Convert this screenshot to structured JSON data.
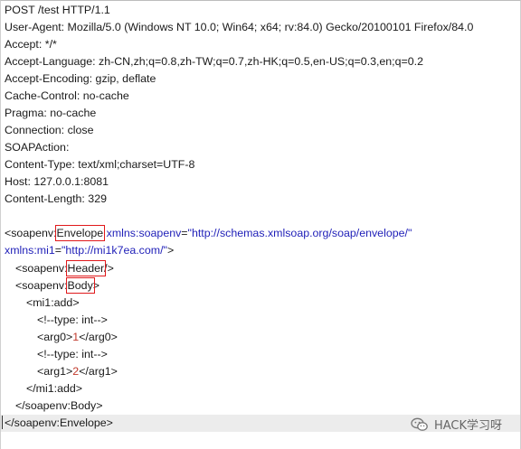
{
  "http": {
    "request_line": "POST /test HTTP/1.1",
    "headers": [
      "User-Agent: Mozilla/5.0 (Windows NT 10.0; Win64; x64; rv:84.0) Gecko/20100101 Firefox/84.0",
      "Accept: */*",
      "Accept-Language: zh-CN,zh;q=0.8,zh-TW;q=0.7,zh-HK;q=0.5,en-US;q=0.3,en;q=0.2",
      "Accept-Encoding: gzip, deflate",
      "Cache-Control: no-cache",
      "Pragma: no-cache",
      "Connection: close",
      "SOAPAction:",
      "Content-Type: text/xml;charset=UTF-8",
      "Host: 127.0.0.1:8081",
      "Content-Length: 329"
    ]
  },
  "body": {
    "envelope_open_prefix": "<soapenv:",
    "envelope_tag": "Envelope",
    "envelope_xmlns_attr": " xmlns:soapenv",
    "envelope_eq": "=",
    "envelope_xmlns_val": "\"http://schemas.xmlsoap.org/soap/envelope/\"",
    "mi1_attr": "xmlns:mi1",
    "mi1_eq": "=",
    "mi1_val": "\"http://mi1k7ea.com/\"",
    "mi1_close": ">",
    "header_prefix": "<soapenv:",
    "header_tag": "Header",
    "header_suffix": "/>",
    "body_prefix": "<soapenv:",
    "body_tag": "Body",
    "body_suffix": ">",
    "add_open": "<mi1:add>",
    "comment1": "<!--type: int-->",
    "arg0_open": "<arg0>",
    "arg0_value": "1",
    "arg0_close": "</arg0>",
    "comment2": "<!--type: int-->",
    "arg1_open": "<arg1>",
    "arg1_value": "2",
    "arg1_close": "</arg1>",
    "add_close": "</mi1:add>",
    "body_close": "</soapenv:Body>",
    "envelope_close": "</soapenv:Envelope>"
  },
  "watermark": {
    "icon": "wechat-icon",
    "text": "HACK学习呀"
  },
  "colors": {
    "highlight_box": "#e0191b",
    "xml_attribute": "#1f1fb8",
    "xml_text_value": "#c0392b",
    "current_line_bg": "#ececec"
  }
}
